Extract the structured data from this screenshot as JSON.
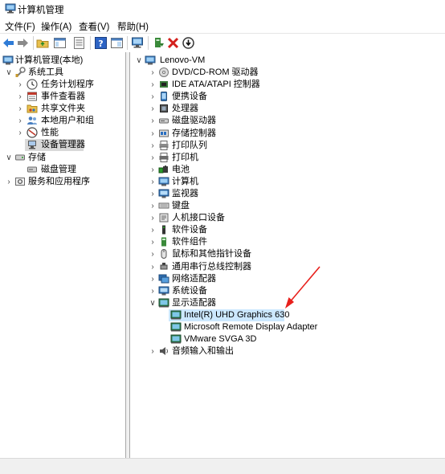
{
  "window": {
    "title": "计算机管理"
  },
  "menu": [
    {
      "label": "文件(F)"
    },
    {
      "label": "操作(A)"
    },
    {
      "label": "查看(V)"
    },
    {
      "label": "帮助(H)"
    }
  ],
  "left_tree": [
    {
      "label": "计算机管理(本地)",
      "icon": "computer-management-icon",
      "expander": "chevron-down"
    },
    {
      "label": "系统工具",
      "icon": "tools-icon",
      "expander": "chevron-down"
    },
    {
      "label": "任务计划程序",
      "icon": "clock-icon",
      "expander": "chevron-right"
    },
    {
      "label": "事件查看器",
      "icon": "event-viewer-icon",
      "expander": "chevron-right"
    },
    {
      "label": "共享文件夹",
      "icon": "shared-folder-icon",
      "expander": "chevron-right"
    },
    {
      "label": "本地用户和组",
      "icon": "users-icon",
      "expander": "chevron-right"
    },
    {
      "label": "性能",
      "icon": "performance-icon",
      "expander": "chevron-right"
    },
    {
      "label": "设备管理器",
      "icon": "device-manager-icon",
      "expander": "none",
      "selected": true
    },
    {
      "label": "存储",
      "icon": "storage-icon",
      "expander": "chevron-down"
    },
    {
      "label": "磁盘管理",
      "icon": "disk-management-icon",
      "expander": "none"
    },
    {
      "label": "服务和应用程序",
      "icon": "services-icon",
      "expander": "chevron-right"
    }
  ],
  "device_tree": {
    "root": {
      "label": "Lenovo-VM",
      "icon": "computer-icon",
      "expander": "chevron-down"
    },
    "categories": [
      {
        "label": "DVD/CD-ROM 驱动器",
        "icon": "dvd-drive-icon"
      },
      {
        "label": "IDE ATA/ATAPI 控制器",
        "icon": "ide-controller-icon"
      },
      {
        "label": "便携设备",
        "icon": "portable-device-icon"
      },
      {
        "label": "处理器",
        "icon": "processor-icon"
      },
      {
        "label": "磁盘驱动器",
        "icon": "disk-drive-icon"
      },
      {
        "label": "存储控制器",
        "icon": "storage-controller-icon"
      },
      {
        "label": "打印队列",
        "icon": "print-queue-icon"
      },
      {
        "label": "打印机",
        "icon": "printer-icon"
      },
      {
        "label": "电池",
        "icon": "battery-icon"
      },
      {
        "label": "计算机",
        "icon": "computer-icon"
      },
      {
        "label": "监视器",
        "icon": "monitor-icon"
      },
      {
        "label": "键盘",
        "icon": "keyboard-icon"
      },
      {
        "label": "人机接口设备",
        "icon": "hid-icon"
      },
      {
        "label": "软件设备",
        "icon": "software-device-icon"
      },
      {
        "label": "软件组件",
        "icon": "software-component-icon"
      },
      {
        "label": "鼠标和其他指针设备",
        "icon": "mouse-icon"
      },
      {
        "label": "通用串行总线控制器",
        "icon": "usb-icon"
      },
      {
        "label": "网络适配器",
        "icon": "network-adapter-icon"
      },
      {
        "label": "系统设备",
        "icon": "system-device-icon"
      },
      {
        "label": "显示适配器",
        "icon": "display-adapter-icon",
        "expanded": true
      }
    ],
    "display_adapters": [
      {
        "label": "Intel(R) UHD Graphics 630",
        "icon": "display-adapter-icon",
        "highlighted": true
      },
      {
        "label": "Microsoft Remote Display Adapter",
        "icon": "display-adapter-icon"
      },
      {
        "label": "VMware SVGA 3D",
        "icon": "display-adapter-icon"
      }
    ],
    "after": [
      {
        "label": "音频输入和输出",
        "icon": "speaker-icon"
      }
    ]
  },
  "colors": {
    "selection_gray": "#d9d9d9",
    "hover_blue": "#cce8ff",
    "annotation_red": "#e8201c"
  }
}
